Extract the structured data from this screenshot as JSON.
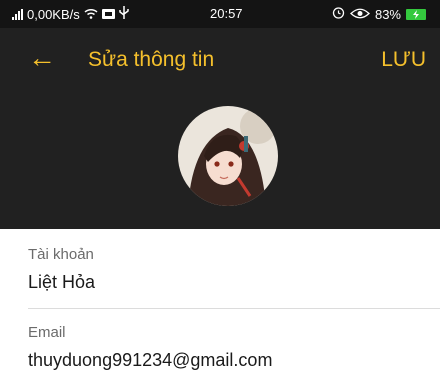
{
  "status_bar": {
    "network_speed": "0,00KB/s",
    "time": "20:57",
    "battery": "83%"
  },
  "header": {
    "back_icon": "arrow-left-icon",
    "title": "Sửa thông tin",
    "save_label": "LƯU"
  },
  "colors": {
    "accent": "#f5c02c",
    "header_bg": "#212121",
    "status_bg": "#141414"
  },
  "form": {
    "account_label": "Tài khoản",
    "account_value": "Liệt Hỏa",
    "email_label": "Email",
    "email_value": "thuyduong991234@gmail.com"
  }
}
